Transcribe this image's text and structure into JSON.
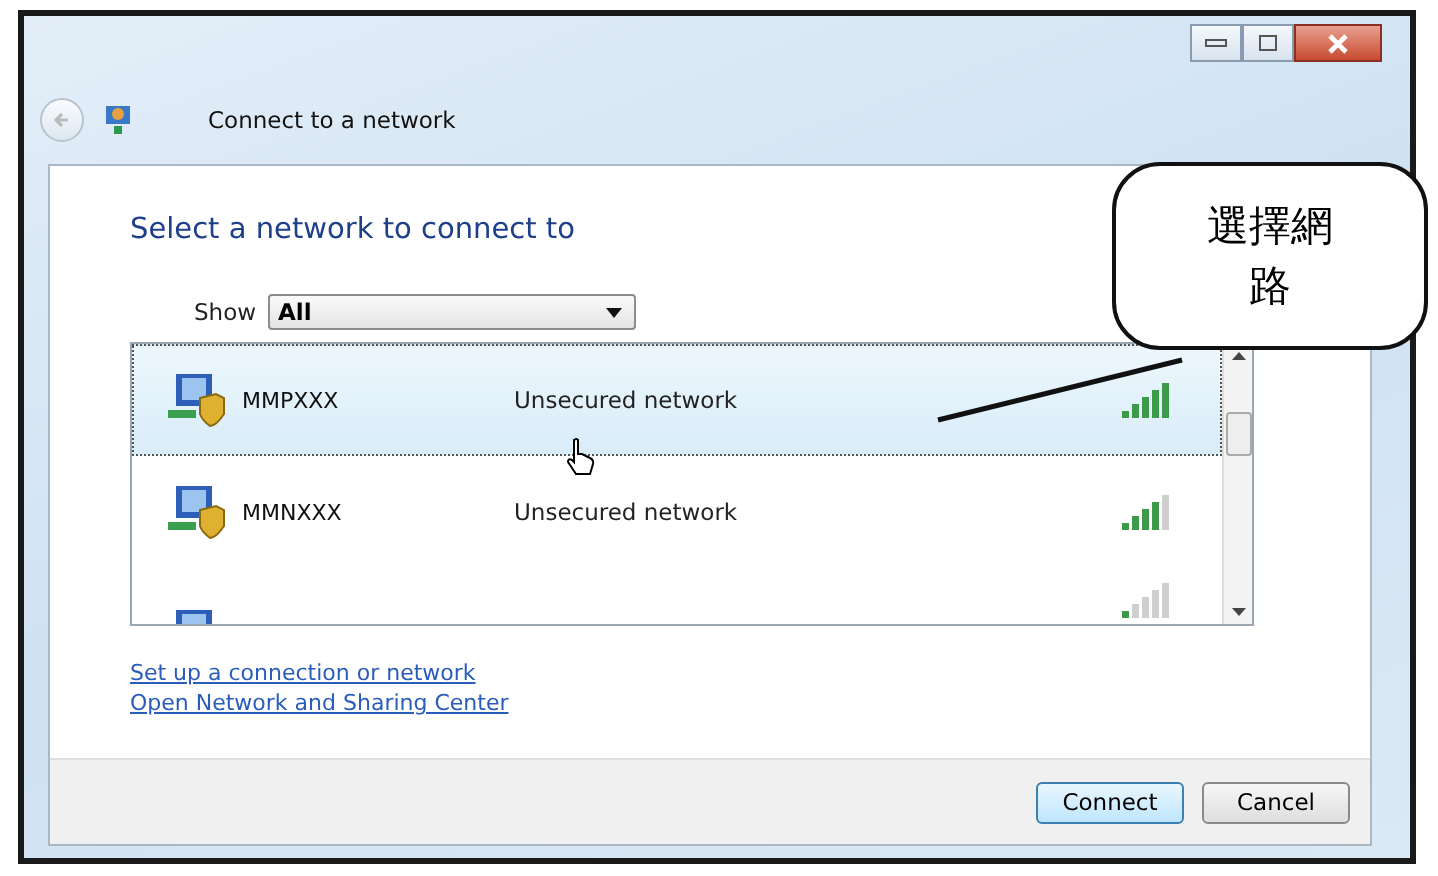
{
  "window": {
    "title": "Connect to a network"
  },
  "heading": "Select a network to connect to",
  "show": {
    "label": "Show",
    "value": "All"
  },
  "networks": [
    {
      "name": "MMPXXX",
      "status": "Unsecured network",
      "kind": "excellent",
      "selected": true
    },
    {
      "name": "MMNXXX",
      "status": "Unsecured network",
      "kind": "good",
      "selected": false
    },
    {
      "kind": "low",
      "selected": false
    }
  ],
  "links": [
    "Set up a connection or network",
    "Open Network and Sharing Center"
  ],
  "buttons": [
    {
      "label": "Connect",
      "kind": "default"
    },
    {
      "label": "Cancel",
      "kind": "normal"
    }
  ],
  "callout": {
    "text": "選擇網路"
  }
}
